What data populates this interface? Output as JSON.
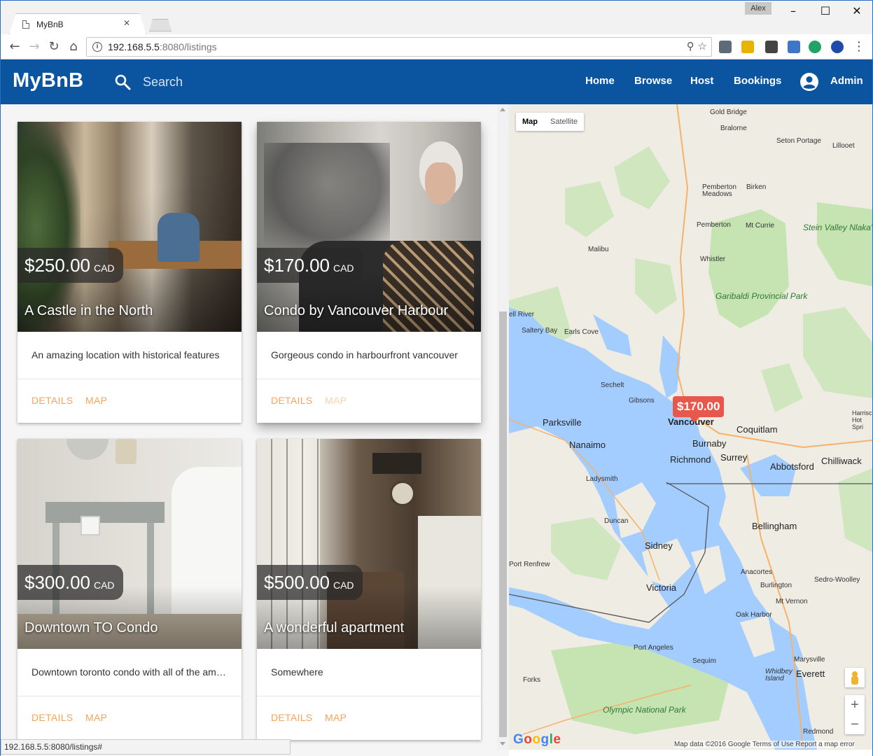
{
  "browser": {
    "tab_title": "MyBnB",
    "user": "Alex",
    "url_host": "192.168.5.5",
    "url_rest": ":8080/listings",
    "status_url": "192.168.5.5:8080/listings#"
  },
  "appbar": {
    "brand": "MyBnB",
    "search_placeholder": "Search",
    "nav": [
      "Home",
      "Browse",
      "Host",
      "Bookings"
    ],
    "account_label": "Admin",
    "color": "#0b54a0"
  },
  "listings": [
    {
      "price": "$250.00",
      "currency": "CAD",
      "title": "A Castle in the North",
      "description": "An amazing location with historical features",
      "details_label": "DETAILS",
      "map_label": "MAP"
    },
    {
      "price": "$170.00",
      "currency": "CAD",
      "title": "Condo by Vancouver Harbour",
      "description": "Gorgeous condo in harbourfront vancouver",
      "details_label": "DETAILS",
      "map_label": "MAP"
    },
    {
      "price": "$300.00",
      "currency": "CAD",
      "title": "Downtown TO Condo",
      "description": "Downtown toronto condo with all of the amenities",
      "details_label": "DETAILS",
      "map_label": "MAP"
    },
    {
      "price": "$500.00",
      "currency": "CAD",
      "title": "A wonderful apartment",
      "description": "Somewhere",
      "details_label": "DETAILS",
      "map_label": "MAP"
    }
  ],
  "map": {
    "type_map": "Map",
    "type_satellite": "Satellite",
    "marker_price": "$170.00",
    "attribution": "Map data ©2016 Google   Terms of Use   Report a map error",
    "logo": "Google",
    "zoom_in": "+",
    "zoom_out": "−",
    "labels": {
      "gold_bridge": "Gold Bridge",
      "bralorne": "Bralorne",
      "seton_portage": "Seton Portage",
      "lillooet": "Lillooet",
      "pemberton_meadows": "Pemberton Meadows",
      "birken": "Birken",
      "pemberton": "Pemberton",
      "mt_currie": "Mt Currie",
      "malibu": "Malibu",
      "whistler": "Whistler",
      "powell_river": "ell River",
      "saltery_bay": "Saltery Bay",
      "earls_cove": "Earls Cove",
      "sechelt": "Sechelt",
      "gibsons": "Gibsons",
      "parksville": "Parksville",
      "vancouver": "Vancouver",
      "coquitlam": "Coquitlam",
      "nanaimo": "Nanaimo",
      "burnaby": "Burnaby",
      "richmond": "Richmond",
      "surrey": "Surrey",
      "abbotsford": "Abbotsford",
      "chilliwack": "Chilliwack",
      "ladysmith": "Ladysmith",
      "duncan": "Duncan",
      "bellingham": "Bellingham",
      "sidney": "Sidney",
      "port_renfrew": "Port Renfrew",
      "victoria": "Victoria",
      "anacortes": "Anacortes",
      "burlington": "Burlington",
      "sedro_woolley": "Sedro-Woolley",
      "mt_vernon": "Mt Vernon",
      "oak_harbor": "Oak Harbor",
      "port_angeles": "Port Angeles",
      "sequim": "Sequim",
      "marysville": "Marysville",
      "forks": "Forks",
      "whidbey_island": "Whidbey Island",
      "everett": "Everett",
      "redmond": "Redmond",
      "harrison": "Harrisc Hot Spri",
      "stein_valley": "Stein Valley Nlaka'pamux Heritage Park",
      "garibaldi": "Garibaldi Provincial Park",
      "olympic": "Olympic National Park"
    }
  },
  "colors": {
    "accent": "#f4a460",
    "marker": "#e8574c",
    "water": "#a3ccff",
    "land": "#efece4",
    "park": "#c6e3b2"
  }
}
